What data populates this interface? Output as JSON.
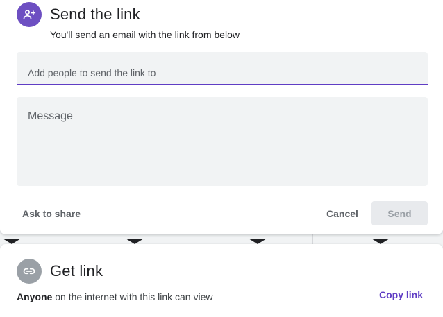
{
  "send_section": {
    "title": "Send the link",
    "subtitle": "You'll send an email with the link from below",
    "icon": "person-add-icon",
    "accent_color": "#6d4fc2",
    "people_input": {
      "placeholder": "Add people to send the link to",
      "value": ""
    },
    "message_input": {
      "placeholder": "Message",
      "value": ""
    },
    "ask_to_share_label": "Ask to share",
    "cancel_label": "Cancel",
    "send_label": "Send"
  },
  "link_section": {
    "title": "Get link",
    "icon": "link-icon",
    "access_bold": "Anyone",
    "access_text": "on the internet with this link can view",
    "copy_label": "Copy link",
    "link_color": "#5f3dc4"
  }
}
